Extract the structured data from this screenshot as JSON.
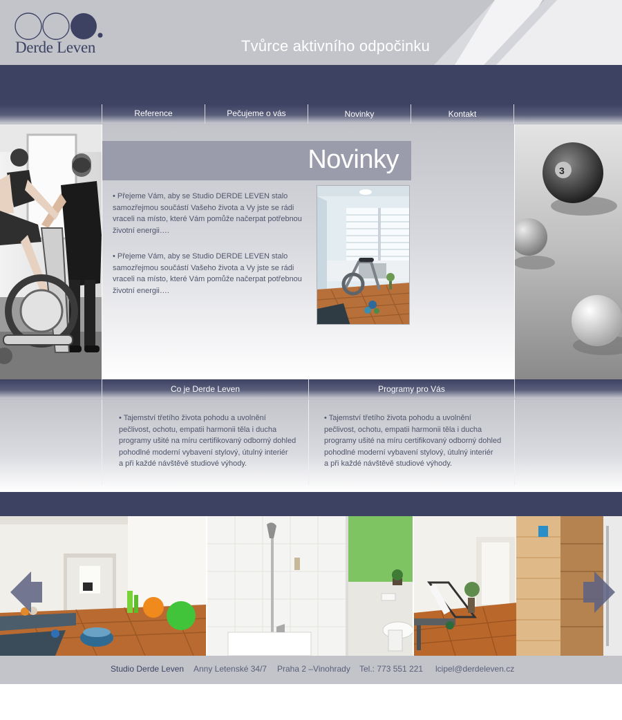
{
  "header": {
    "logo_text": "Derde Leven",
    "tagline": "Tvůrce aktivního odpočinku"
  },
  "nav": {
    "items": [
      {
        "label": "Reference"
      },
      {
        "label": "Pečujeme o vás"
      },
      {
        "label": "Novinky"
      },
      {
        "label": "Kontakt"
      }
    ]
  },
  "main": {
    "title": "Novinky",
    "news": [
      {
        "text": "• Přejeme Vám, aby se Studio DERDE LEVEN stalo samozřejmou součástí Vašeho života a Vy jste se rádi vraceli na místo, které Vám pomůže načerpat potřebnou životní energii…."
      },
      {
        "text": "• Přejeme Vám, aby se Studio DERDE LEVEN stalo samozřejmou součástí Vašeho života a Vy jste se rádi vraceli na místo, které Vám pomůže načerpat potřebnou životní energii…."
      }
    ]
  },
  "sections": [
    {
      "title": "Co je Derde Leven",
      "lines": [
        "• Tajemství třetího života pohodu a uvolnění",
        "pečlivost, ochotu, empatii harmonii těla i ducha",
        "programy ušité na míru certifikovaný odborný dohled",
        "pohodlné moderní vybavení stylový, útulný interiér",
        "a při každé návštěvě studiové výhody."
      ]
    },
    {
      "title": "Programy pro Vás",
      "lines": [
        "• Tajemství třetího života pohodu a uvolnění",
        "pečlivost, ochotu, empatii harmonii těla i ducha",
        "programy ušité na míru certifikovaný odborný dohled",
        "pohodlné moderní vybavení stylový, útulný interiér",
        "a při každé návštěvě studiové výhody."
      ]
    }
  ],
  "footer": {
    "brand": "Studio Derde Leven",
    "address": "Anny Letenské 34/7",
    "city": "Praha 2 –Vinohrady",
    "phone": "Tel.: 773 551 221",
    "email": "lcipel@derdeleven.cz"
  },
  "colors": {
    "navy": "#3d4263",
    "grey": "#c2c4ca",
    "title_bar": "#9a9cab"
  }
}
